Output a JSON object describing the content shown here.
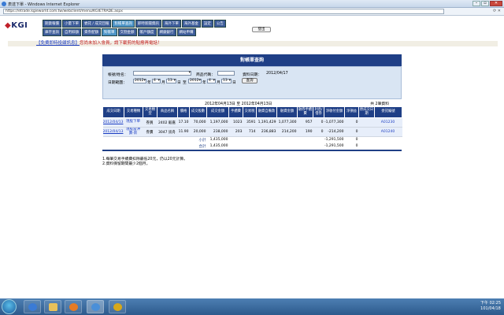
{
  "window": {
    "title": "表達下單 - Windows Internet Explorer",
    "url": "https://etrade.kgieworld.com.tw/webclient/menu/KGIETRADE.aspx"
  },
  "logo": "KGI",
  "nav": {
    "row1": [
      "期貨報價",
      "小量下單",
      "委託 / 成交回報",
      "對帳單查詢",
      "即時新聞資訊",
      "海外下單",
      "海外基金",
      "設定",
      "公告"
    ],
    "row2": [
      "庫存查詢",
      "自用餘額",
      "資券配額",
      "對帳單",
      "交割金額",
      "帳戶額度",
      "網銀銀行",
      "網站申購"
    ],
    "logout": "登出"
  },
  "banner": {
    "link": "【免費即時投顧訊息】",
    "text": "您尚未加入會員，請下載剪的貼撥再電話！"
  },
  "panel": {
    "title": "對帳單查詢",
    "account_label": "帳號/姓名：",
    "account_value": "",
    "stock_code_label": "商品代碼：",
    "stock_code_value": "",
    "data_date_label": "資料日期：",
    "data_date_value": "2012/04/17",
    "date_range_label": "日期範圍：",
    "from": {
      "year": "2012",
      "y_unit": "年",
      "month": "4",
      "m_unit": "月",
      "day": "13",
      "d_unit": "日"
    },
    "to_label": "至",
    "to": {
      "year": "2012",
      "y_unit": "年",
      "month": "4",
      "m_unit": "月",
      "day": "13",
      "d_unit": "日"
    },
    "query_button": "查詢",
    "range_text": "2012年04月13日 至 2012年04月13日",
    "count_text": "共 2筆資料"
  },
  "table": {
    "headers": [
      "成交日期",
      "交易種類",
      "交易類型",
      "商品名稱",
      "價格",
      "成交股數",
      "成交金額",
      "手續費",
      "交易稅",
      "融資自備款",
      "融資金額",
      "融券手續費",
      "利息/借券",
      "淨收付金額",
      "淨損益",
      "原成交日期",
      "委託編號"
    ],
    "rows": [
      [
        "2012/04/13",
        "現股下單",
        "券買",
        "2402 毅嘉",
        "17.10",
        "70,000",
        "1,197,000",
        "1023",
        "3591",
        "1,191,429",
        "1,077,300",
        "957",
        "0",
        "-1,077,300",
        "0",
        "",
        "A01230"
      ],
      [
        "2012/04/13",
        "現股當沖賣-新",
        "券賣",
        "3047 訊舟",
        "11.90",
        "20,000",
        "238,000",
        "203",
        "714",
        "236,883",
        "214,200",
        "190",
        "0",
        "-214,200",
        "0",
        "",
        "A01240"
      ]
    ],
    "subtotal": {
      "label": "小計",
      "shares": "1,435,000",
      "net": "-1,291,500",
      "profit": "0"
    },
    "total": {
      "label": "合計",
      "shares": "1,435,000",
      "net": "-1,291,500",
      "profit": "0"
    }
  },
  "notes": [
    "1.每筆交易手續費扣除最低20元，仍以20元計算。",
    "2.資料保留期間最少2個月。"
  ],
  "taskbar": {
    "time": "下午 02:25",
    "date": "101/04/18"
  }
}
